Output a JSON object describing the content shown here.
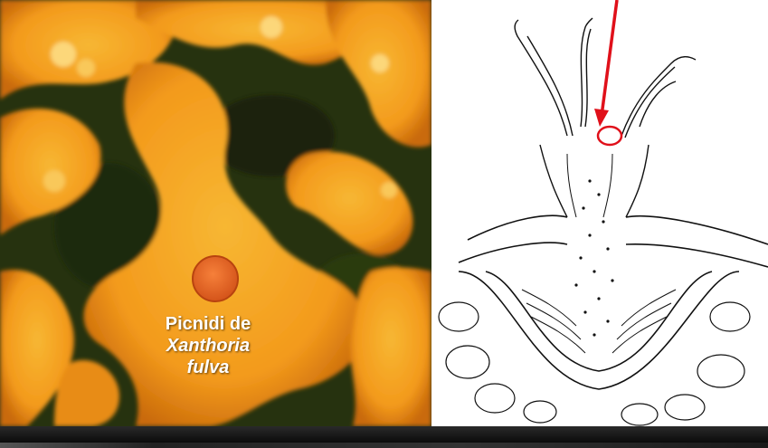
{
  "caption": {
    "line1": "Picnidi de",
    "line2": "Xanthoria",
    "line3": "fulva"
  },
  "colors": {
    "lichen_orange": "#f39a1c",
    "lichen_yellow": "#f7b733",
    "dark_background": "#1f2a0c",
    "pointer_red": "#e0101a",
    "drawing_ink": "#111111"
  },
  "icons": [
    "red-arrow",
    "red-circle-marker"
  ]
}
